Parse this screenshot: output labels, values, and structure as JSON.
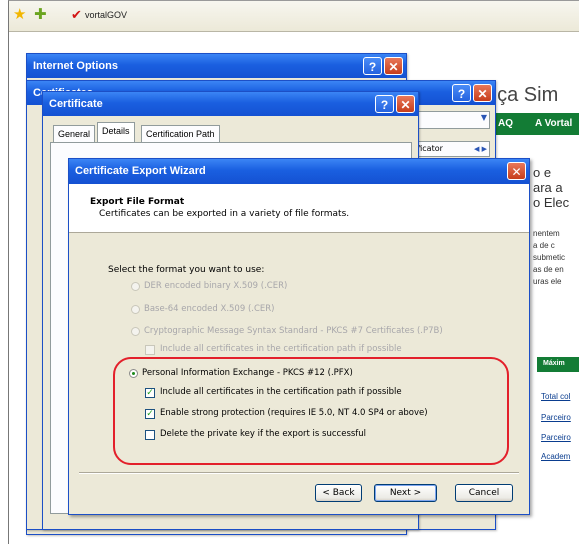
{
  "browser": {
    "tab_title": "vortalGOV"
  },
  "site": {
    "heading": "nça Sim",
    "nav": [
      "AQ",
      "A Vortal"
    ],
    "text_lines": [
      "o e",
      "ara a",
      "o Elec",
      "nentem",
      "a de c",
      "submetic",
      "as de en",
      "uras ele"
    ],
    "green_label": "Máxim",
    "links": [
      "Total col",
      "Parceiro",
      "Parceiro",
      "Academ"
    ]
  },
  "windows": {
    "internet_options": {
      "title": "Internet Options"
    },
    "certificates": {
      "title": "Certificates"
    },
    "certificate": {
      "title": "Certificate",
      "tabs": [
        "General",
        "Details",
        "Certification Path"
      ],
      "side_tab": "ificator"
    }
  },
  "wizard": {
    "title": "Certificate Export Wizard",
    "header_title": "Export File Format",
    "header_subtitle": "Certificates can be exported in a variety of file formats.",
    "prompt": "Select the format you want to use:",
    "options": [
      {
        "label": "DER encoded binary X.509 (.CER)",
        "enabled": false,
        "selected": false
      },
      {
        "label": "Base-64 encoded X.509 (.CER)",
        "enabled": false,
        "selected": false
      },
      {
        "label": "Cryptographic Message Syntax Standard - PKCS #7 Certificates (.P7B)",
        "enabled": false,
        "selected": false
      },
      {
        "label": "Personal Information Exchange - PKCS #12 (.PFX)",
        "enabled": true,
        "selected": true
      }
    ],
    "p7b_checkbox": {
      "label": "Include all certificates in the certification path if possible",
      "checked": false,
      "enabled": false
    },
    "pfx_checkboxes": [
      {
        "label": "Include all certificates in the certification path if possible",
        "checked": true
      },
      {
        "label": "Enable strong protection (requires IE 5.0, NT 4.0 SP4 or above)",
        "checked": true
      },
      {
        "label": "Delete the private key if the export is successful",
        "checked": false
      }
    ],
    "buttons": {
      "back": "< Back",
      "next": "Next >",
      "cancel": "Cancel"
    }
  },
  "colors": {
    "highlight": "#e3202b",
    "xp_title": "#1a5fe0",
    "site_green": "#137c35"
  }
}
